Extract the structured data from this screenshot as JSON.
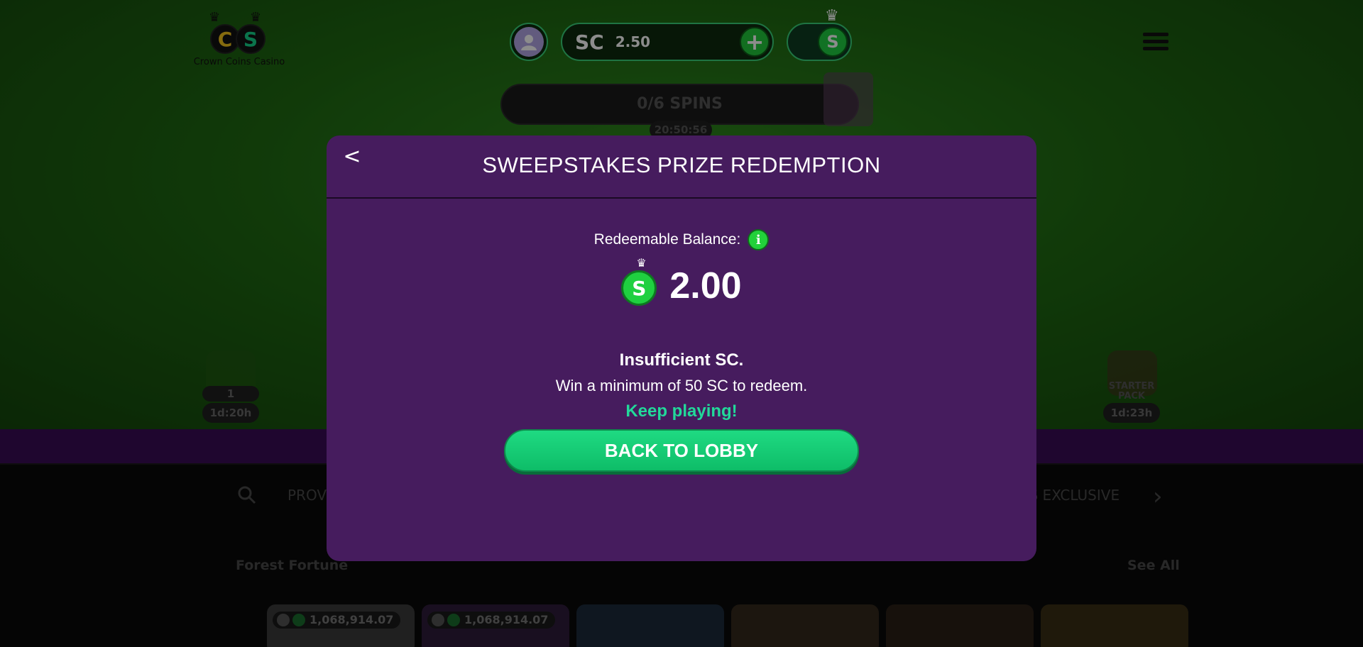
{
  "header": {
    "logo_text": "Crown Coins Casino",
    "logo_letters": [
      "C",
      "S"
    ],
    "balance_currency": "SC",
    "balance_value": "2.50",
    "add_label": "+",
    "toggle_coin": "S"
  },
  "promo": {
    "spins": "0/6 SPINS",
    "timer": "20:50:56",
    "left_badge_count": "1",
    "left_badge_timer": "1d:20h",
    "right_badge_label": "STARTER PACK",
    "right_badge_timer": "1d:23h"
  },
  "lobby": {
    "category_left": "PROV",
    "category_right": "'S EXCLUSIVE",
    "section_title": "Forest Fortune",
    "see_all": "See All",
    "jackpots": [
      "1,068,914.07",
      "1,068,914.07"
    ]
  },
  "modal": {
    "back_label": "<",
    "title": "SWEEPSTAKES PRIZE REDEMPTION",
    "balance_label": "Redeemable Balance:",
    "info_label": "i",
    "coin_label": "S",
    "amount": "2.00",
    "insufficient": "Insufficient SC.",
    "min_text": "Win a minimum of 50 SC to redeem.",
    "keep_playing": "Keep playing!",
    "lobby_button": "BACK TO LOBBY"
  },
  "colors": {
    "modal_bg": "#461c5e",
    "accent_green": "#1fda82",
    "keep_playing": "#22d99a",
    "coin_green": "#1fd040"
  },
  "icons": [
    "crown-icon",
    "user-icon",
    "plus-icon",
    "menu-icon",
    "gift-icon",
    "search-icon",
    "chevron-right-icon",
    "chevron-left-icon",
    "info-icon",
    "sc-coin-icon"
  ]
}
